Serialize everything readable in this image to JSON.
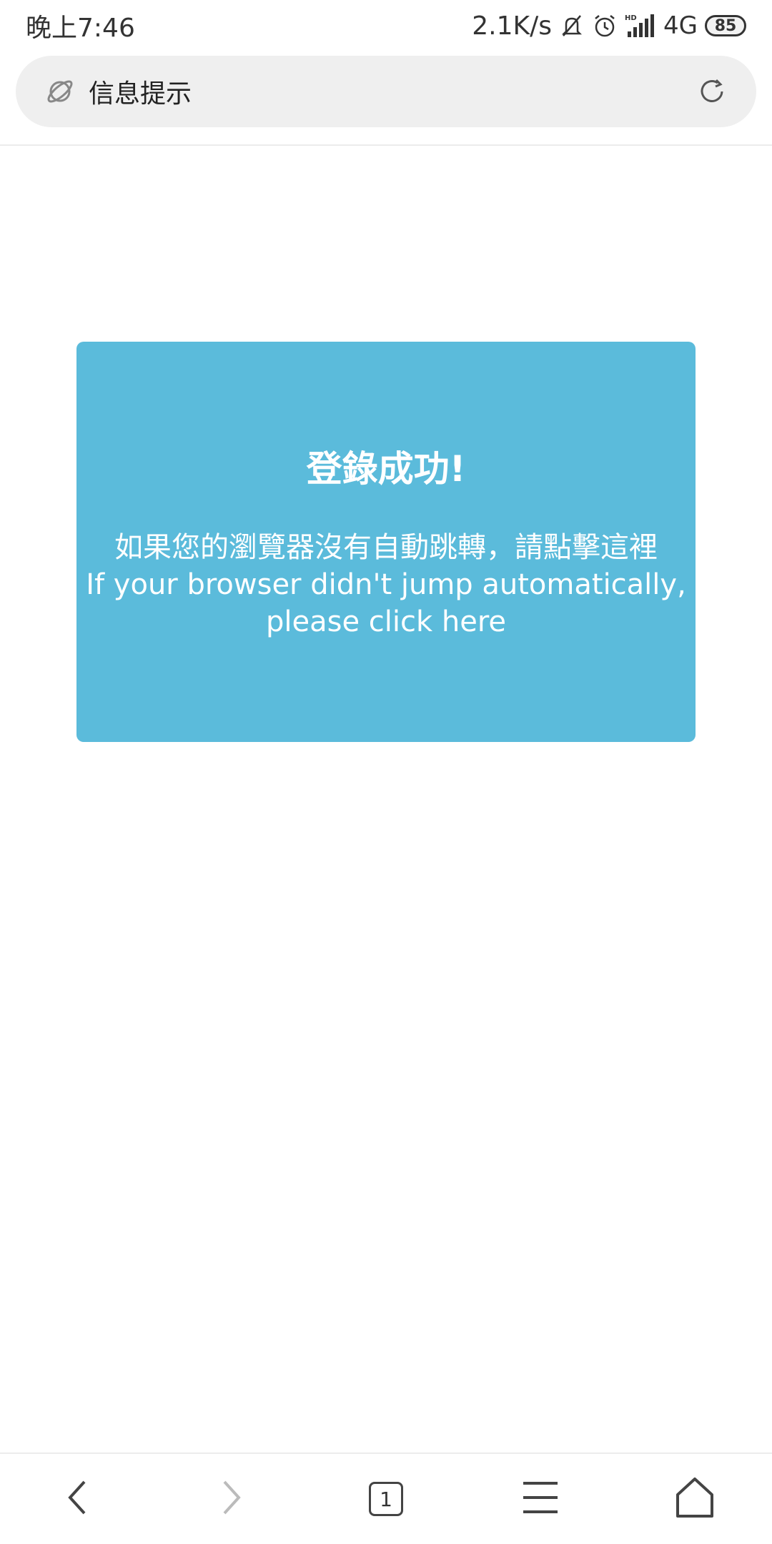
{
  "status_bar": {
    "time": "晚上7:46",
    "net_speed": "2.1K/s",
    "network": "4G",
    "battery": "85",
    "icons": [
      "mute-bell-icon",
      "alarm-icon",
      "hd-signal-icon",
      "battery-icon"
    ]
  },
  "address_bar": {
    "title": "信息提示",
    "site_icon": "planet-icon",
    "action_icon": "refresh-icon"
  },
  "card": {
    "title": "登錄成功!",
    "message_zh": "如果您的瀏覽器沒有自動跳轉，請點擊這裡",
    "message_en_line1": "If your browser didn't jump automatically,",
    "message_en_line2": "please click here",
    "background": "#5bbbdb"
  },
  "bottom_nav": {
    "tab_count": "1",
    "icons": [
      "back-icon",
      "forward-icon",
      "tabs-icon",
      "menu-icon",
      "home-icon"
    ]
  }
}
